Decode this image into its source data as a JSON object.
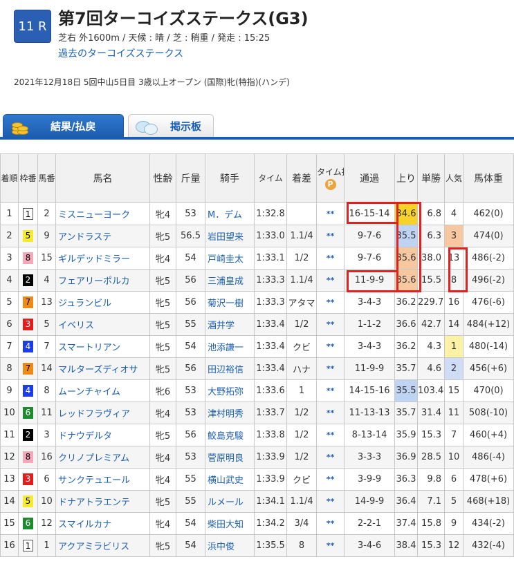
{
  "race": {
    "number": "11 R",
    "title": "第7回ターコイズステークス(G3)",
    "conditions": "芝右 外1600m / 天候 : 晴 / 芝 : 稍重 / 発走 : 15:25",
    "past_link": "過去のターコイズステークス",
    "info": "2021年12月18日 5回中山5日目 3歳以上オープン (国際)牝(特指)(ハンデ)"
  },
  "tabs": [
    {
      "label": "結果/払戻",
      "icon": "coins-icon"
    },
    {
      "label": "掲示板",
      "icon": "chat-bubble-icon"
    }
  ],
  "colors": {
    "tab_active": "#1c5cae",
    "link": "#1a5fb4",
    "highlight": "#e12020"
  },
  "table": {
    "headers": {
      "finish": "着順",
      "waku": "枠番",
      "horse_no": "馬番",
      "horse": "馬名",
      "sex_age": "性齢",
      "weight": "斤量",
      "jockey": "騎手",
      "time": "タイム",
      "margin": "着差",
      "time_index": "タイム指数",
      "time_index_mark": "P",
      "passing": "通過",
      "last3f": "上り",
      "odds": "単勝",
      "popularity": "人気",
      "body_weight": "馬体重"
    },
    "rows": [
      {
        "finish": "1",
        "waku": "1",
        "no": "2",
        "horse": "ミスニューヨーク",
        "sex_age": "牝4",
        "weight": "53",
        "jockey": "M．デム",
        "time": "1:32.8",
        "margin": "",
        "ti": "**",
        "passing": "16-15-14",
        "last3f": "34.6",
        "odds": "6.8",
        "pop": "4",
        "body": "462(0)",
        "up": "up1",
        "pc": ""
      },
      {
        "finish": "2",
        "waku": "5",
        "no": "9",
        "horse": "アンドラステ",
        "sex_age": "牝5",
        "weight": "56.5",
        "jockey": "岩田望来",
        "time": "1:33.0",
        "margin": "1.1/4",
        "ti": "**",
        "passing": "9-7-6",
        "last3f": "35.5",
        "odds": "6.3",
        "pop": "3",
        "body": "474(0)",
        "up": "up2",
        "pc": "pop3"
      },
      {
        "finish": "3",
        "waku": "8",
        "no": "15",
        "horse": "ギルデッドミラー",
        "sex_age": "牝4",
        "weight": "54",
        "jockey": "戸崎圭太",
        "time": "1:33.1",
        "margin": "1/2",
        "ti": "**",
        "passing": "9-7-6",
        "last3f": "35.6",
        "odds": "38.0",
        "pop": "13",
        "body": "486(-2)",
        "up": "up3",
        "pc": ""
      },
      {
        "finish": "4",
        "waku": "2",
        "no": "4",
        "horse": "フェアリーポルカ",
        "sex_age": "牝5",
        "weight": "56",
        "jockey": "三浦皇成",
        "time": "1:33.3",
        "margin": "1.1/4",
        "ti": "**",
        "passing": "11-9-9",
        "last3f": "35.6",
        "odds": "15.5",
        "pop": "8",
        "body": "496(-2)",
        "up": "up3",
        "pc": ""
      },
      {
        "finish": "5",
        "waku": "7",
        "no": "13",
        "horse": "ジュランビル",
        "sex_age": "牝5",
        "weight": "56",
        "jockey": "菊沢一樹",
        "time": "1:33.3",
        "margin": "アタマ",
        "ti": "**",
        "passing": "3-4-3",
        "last3f": "36.2",
        "odds": "229.7",
        "pop": "16",
        "body": "476(-6)",
        "up": "",
        "pc": ""
      },
      {
        "finish": "6",
        "waku": "3",
        "no": "5",
        "horse": "イベリス",
        "sex_age": "牝5",
        "weight": "55",
        "jockey": "酒井学",
        "time": "1:33.4",
        "margin": "1/2",
        "ti": "**",
        "passing": "1-1-2",
        "last3f": "36.6",
        "odds": "42.7",
        "pop": "14",
        "body": "484(+12)",
        "up": "",
        "pc": ""
      },
      {
        "finish": "7",
        "waku": "4",
        "no": "7",
        "horse": "スマートリアン",
        "sex_age": "牝5",
        "weight": "54",
        "jockey": "池添謙一",
        "time": "1:33.4",
        "margin": "クビ",
        "ti": "**",
        "passing": "3-4-3",
        "last3f": "36.2",
        "odds": "4.3",
        "pop": "1",
        "body": "480(-14)",
        "up": "",
        "pc": "pop1"
      },
      {
        "finish": "8",
        "waku": "7",
        "no": "14",
        "horse": "マルターズディオサ",
        "sex_age": "牝5",
        "weight": "56",
        "jockey": "田辺裕信",
        "time": "1:33.4",
        "margin": "ハナ",
        "ti": "**",
        "passing": "11-9-9",
        "last3f": "35.7",
        "odds": "4.6",
        "pop": "2",
        "body": "456(+6)",
        "up": "",
        "pc": "pop2"
      },
      {
        "finish": "9",
        "waku": "4",
        "no": "8",
        "horse": "ムーンチャイム",
        "sex_age": "牝6",
        "weight": "53",
        "jockey": "大野拓弥",
        "time": "1:33.6",
        "margin": "1",
        "ti": "**",
        "passing": "14-15-16",
        "last3f": "35.5",
        "odds": "103.4",
        "pop": "15",
        "body": "470(0)",
        "up": "up2",
        "pc": ""
      },
      {
        "finish": "10",
        "waku": "6",
        "no": "11",
        "horse": "レッドフラヴィア",
        "sex_age": "牝4",
        "weight": "53",
        "jockey": "津村明秀",
        "time": "1:33.7",
        "margin": "1/2",
        "ti": "**",
        "passing": "11-13-13",
        "last3f": "35.7",
        "odds": "31.4",
        "pop": "11",
        "body": "508(-10)",
        "up": "",
        "pc": ""
      },
      {
        "finish": "11",
        "waku": "2",
        "no": "3",
        "horse": "ドナウデルタ",
        "sex_age": "牝5",
        "weight": "56",
        "jockey": "鮫島克駿",
        "time": "1:33.8",
        "margin": "1/2",
        "ti": "**",
        "passing": "8-13-14",
        "last3f": "35.9",
        "odds": "15.3",
        "pop": "7",
        "body": "460(+4)",
        "up": "",
        "pc": ""
      },
      {
        "finish": "12",
        "waku": "8",
        "no": "16",
        "horse": "クリノプレミアム",
        "sex_age": "牝4",
        "weight": "53",
        "jockey": "菅原明良",
        "time": "1:33.9",
        "margin": "1/2",
        "ti": "**",
        "passing": "3-3-3",
        "last3f": "36.9",
        "odds": "28.5",
        "pop": "10",
        "body": "486(-4)",
        "up": "",
        "pc": ""
      },
      {
        "finish": "13",
        "waku": "3",
        "no": "6",
        "horse": "サンクテュエール",
        "sex_age": "牝4",
        "weight": "55",
        "jockey": "横山武史",
        "time": "1:33.9",
        "margin": "クビ",
        "ti": "**",
        "passing": "3-9-9",
        "last3f": "36.3",
        "odds": "9.8",
        "pop": "6",
        "body": "478(+6)",
        "up": "",
        "pc": ""
      },
      {
        "finish": "14",
        "waku": "5",
        "no": "10",
        "horse": "ドナアトラエンテ",
        "sex_age": "牝5",
        "weight": "55",
        "jockey": "ルメール",
        "time": "1:34.1",
        "margin": "1.1/4",
        "ti": "**",
        "passing": "14-9-9",
        "last3f": "36.4",
        "odds": "7.1",
        "pop": "5",
        "body": "468(+18)",
        "up": "",
        "pc": ""
      },
      {
        "finish": "15",
        "waku": "6",
        "no": "12",
        "horse": "スマイルカナ",
        "sex_age": "牝4",
        "weight": "54",
        "jockey": "柴田大知",
        "time": "1:34.2",
        "margin": "3/4",
        "ti": "**",
        "passing": "2-2-1",
        "last3f": "37.4",
        "odds": "15.8",
        "pop": "9",
        "body": "434(-2)",
        "up": "",
        "pc": ""
      },
      {
        "finish": "16",
        "waku": "1",
        "no": "1",
        "horse": "アクアミラビリス",
        "sex_age": "牝5",
        "weight": "54",
        "jockey": "浜中俊",
        "time": "1:35.5",
        "margin": "8",
        "ti": "**",
        "passing": "3-4-6",
        "last3f": "38.4",
        "odds": "15.3",
        "pop": "12",
        "body": "432(-4)",
        "up": "",
        "pc": ""
      }
    ]
  }
}
